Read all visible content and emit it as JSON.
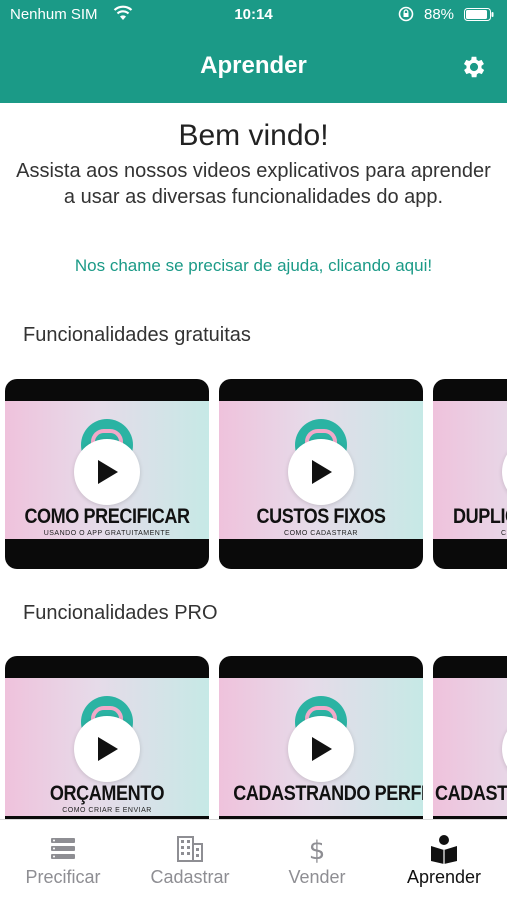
{
  "status_bar": {
    "carrier": "Nenhum SIM",
    "time": "10:14",
    "battery": "88%"
  },
  "header": {
    "title": "Aprender",
    "settings_icon": "gear-icon"
  },
  "welcome": {
    "title": "Bem vindo!",
    "text": "Assista aos nossos videos explicativos para aprender a usar as diversas funcionalidades do app.",
    "help_link": "Nos chame se precisar de ajuda, clicando aqui!"
  },
  "sections": [
    {
      "title": "Funcionalidades gratuitas",
      "videos": [
        {
          "title": "COMO PRECIFICAR",
          "subtitle": "USANDO O APP GRATUITAMENTE"
        },
        {
          "title": "CUSTOS FIXOS",
          "subtitle": "COMO CADASTRAR"
        },
        {
          "title": "DUPLIC",
          "subtitle": "C"
        }
      ]
    },
    {
      "title": "Funcionalidades PRO",
      "videos": [
        {
          "title": "ORÇAMENTO",
          "subtitle": "COMO CRIAR E ENVIAR"
        },
        {
          "title": "CADASTRANDO PERFIL",
          "subtitle": ""
        },
        {
          "title": "CADASTR",
          "subtitle": ""
        }
      ]
    }
  ],
  "tabs": [
    {
      "label": "Precificar",
      "icon": "list-icon",
      "active": false
    },
    {
      "label": "Cadastrar",
      "icon": "building-icon",
      "active": false
    },
    {
      "label": "Vender",
      "icon": "dollar-icon",
      "active": false
    },
    {
      "label": "Aprender",
      "icon": "book-reader-icon",
      "active": true
    }
  ],
  "colors": {
    "primary": "#1b9a87",
    "tab_inactive": "#8e8e93",
    "tab_active": "#111111"
  }
}
